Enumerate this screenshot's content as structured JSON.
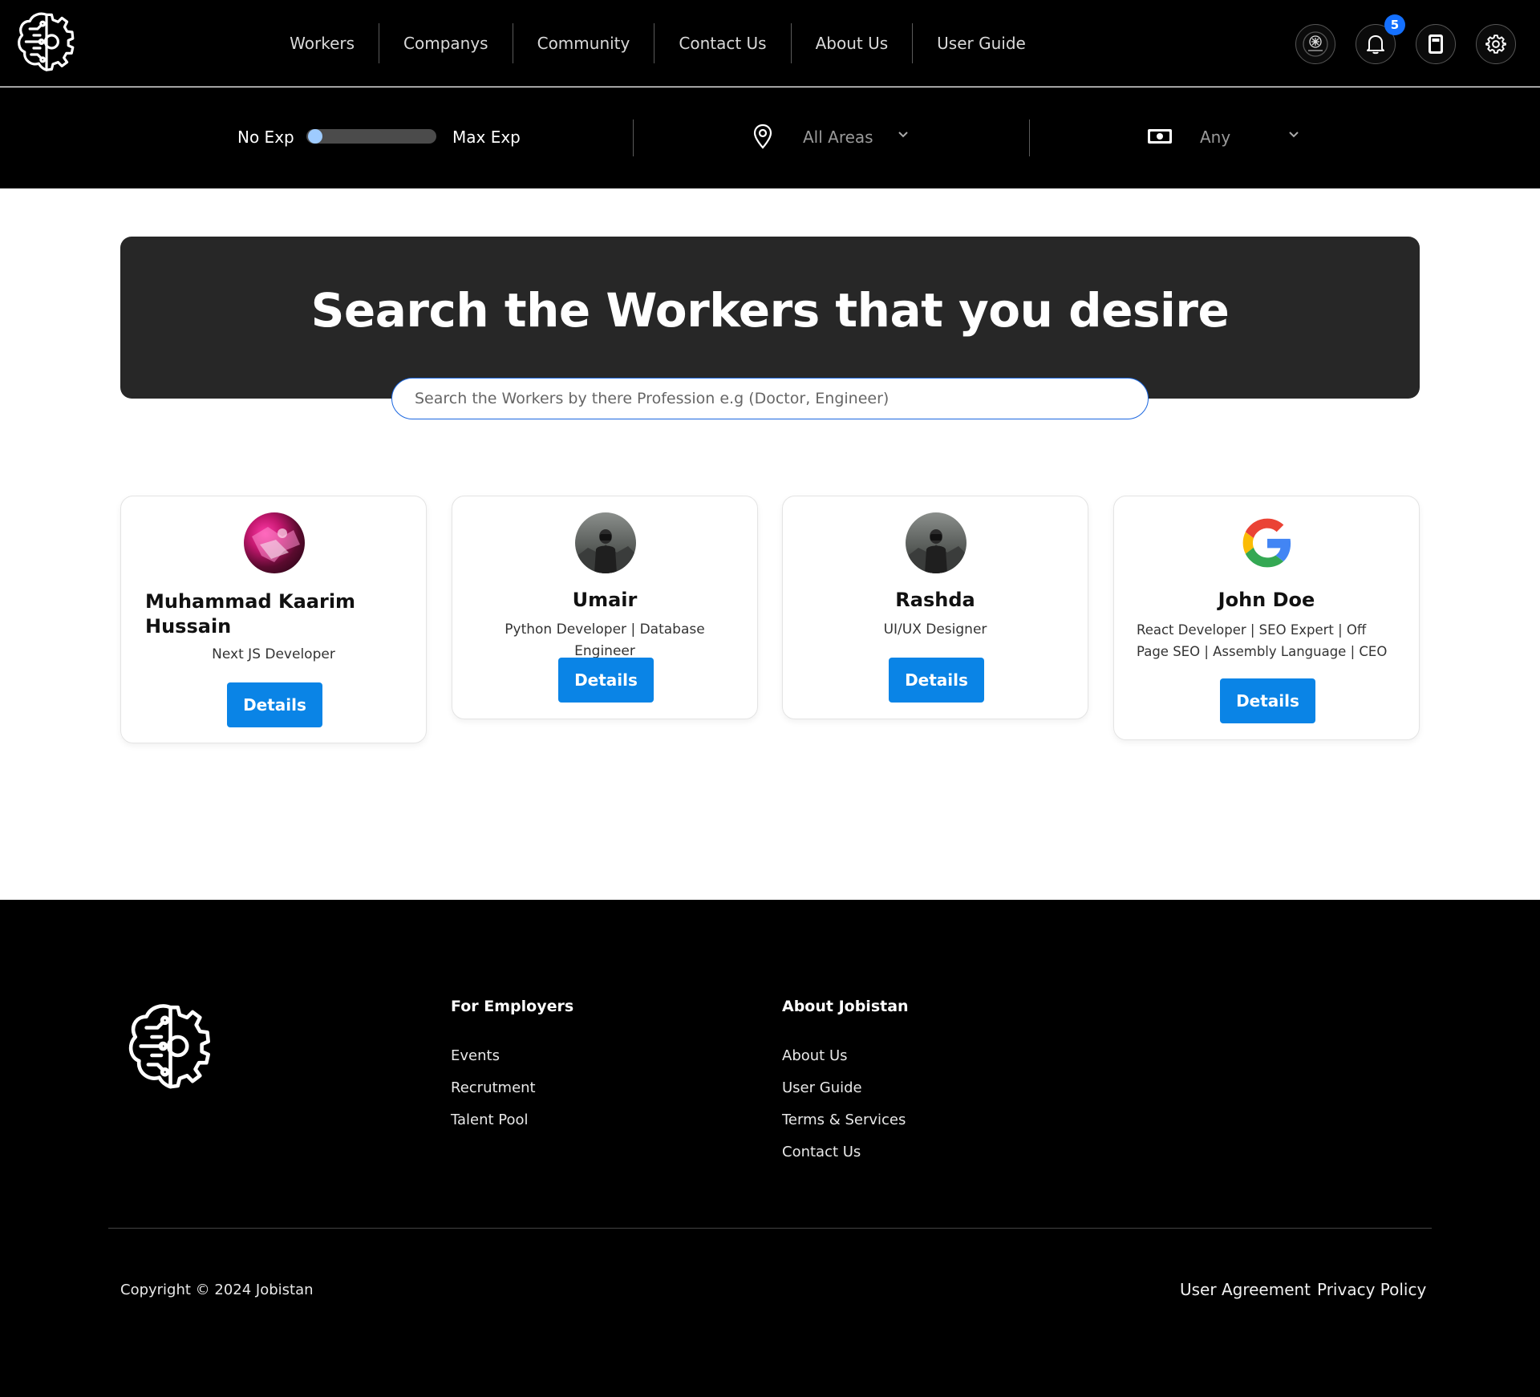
{
  "nav": {
    "items": [
      {
        "label": "Workers"
      },
      {
        "label": "Companys"
      },
      {
        "label": "Community"
      },
      {
        "label": "Contact Us"
      },
      {
        "label": "About Us"
      },
      {
        "label": "User Guide"
      }
    ],
    "notification_count": "5",
    "icons": [
      "profile-avatar-icon",
      "bell-icon",
      "calculator-icon",
      "gear-icon"
    ]
  },
  "filters": {
    "experience_min_label": "No Exp",
    "experience_max_label": "Max Exp",
    "experience_value": 0,
    "location_value": "All Areas",
    "salary_value": "Any"
  },
  "hero": {
    "title": "Search the Workers that you desire",
    "search_placeholder": "Search the Workers by there Profession e.g (Doctor, Engineer)"
  },
  "workers": [
    {
      "name": "Muhammad Kaarim Hussain",
      "role": "Next JS Developer",
      "button": "Details",
      "avatar": "pink-abstract-avatar"
    },
    {
      "name": "Umair",
      "role": "Python Developer | Database Engineer",
      "button": "Details",
      "avatar": "photographer-avatar"
    },
    {
      "name": "Rashda",
      "role": "UI/UX Designer",
      "button": "Details",
      "avatar": "photographer-avatar"
    },
    {
      "name": "John Doe",
      "role": "React Developer | SEO Expert | Off Page SEO | Assembly Language | CEO",
      "button": "Details",
      "avatar": "google-logo"
    }
  ],
  "footer": {
    "employers_heading": "For Employers",
    "employers_links": [
      "Events",
      "Recrutment",
      "Talent Pool"
    ],
    "about_heading": "About Jobistan",
    "about_links": [
      "About Us",
      "User Guide",
      "Terms & Services",
      "Contact Us"
    ],
    "copyright": "Copyright © 2024 Jobistan",
    "user_agreement": "User Agreement",
    "privacy_policy": "Privacy Policy"
  },
  "colors": {
    "primary_button": "#0a84e6",
    "badge": "#1470ff",
    "hero_background": "#272727",
    "search_border": "#1a66e0"
  }
}
